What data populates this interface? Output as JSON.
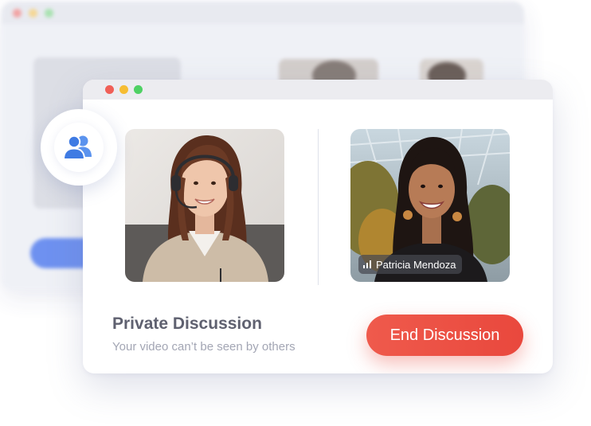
{
  "call": {
    "title": "Private Discussion",
    "subtitle": "Your video can’t be seen by others",
    "end_button_label": "End Discussion"
  },
  "participants": [
    {
      "name": ""
    },
    {
      "name": "Patricia Mendoza"
    }
  ],
  "icons": {
    "badge": "people-group-icon",
    "signal": "signal-bars-icon"
  },
  "colors": {
    "accent": "#3f7be3",
    "end_button": "#ea4b3f",
    "title_text": "#5f6170",
    "subtitle_text": "#a3a6b4"
  }
}
